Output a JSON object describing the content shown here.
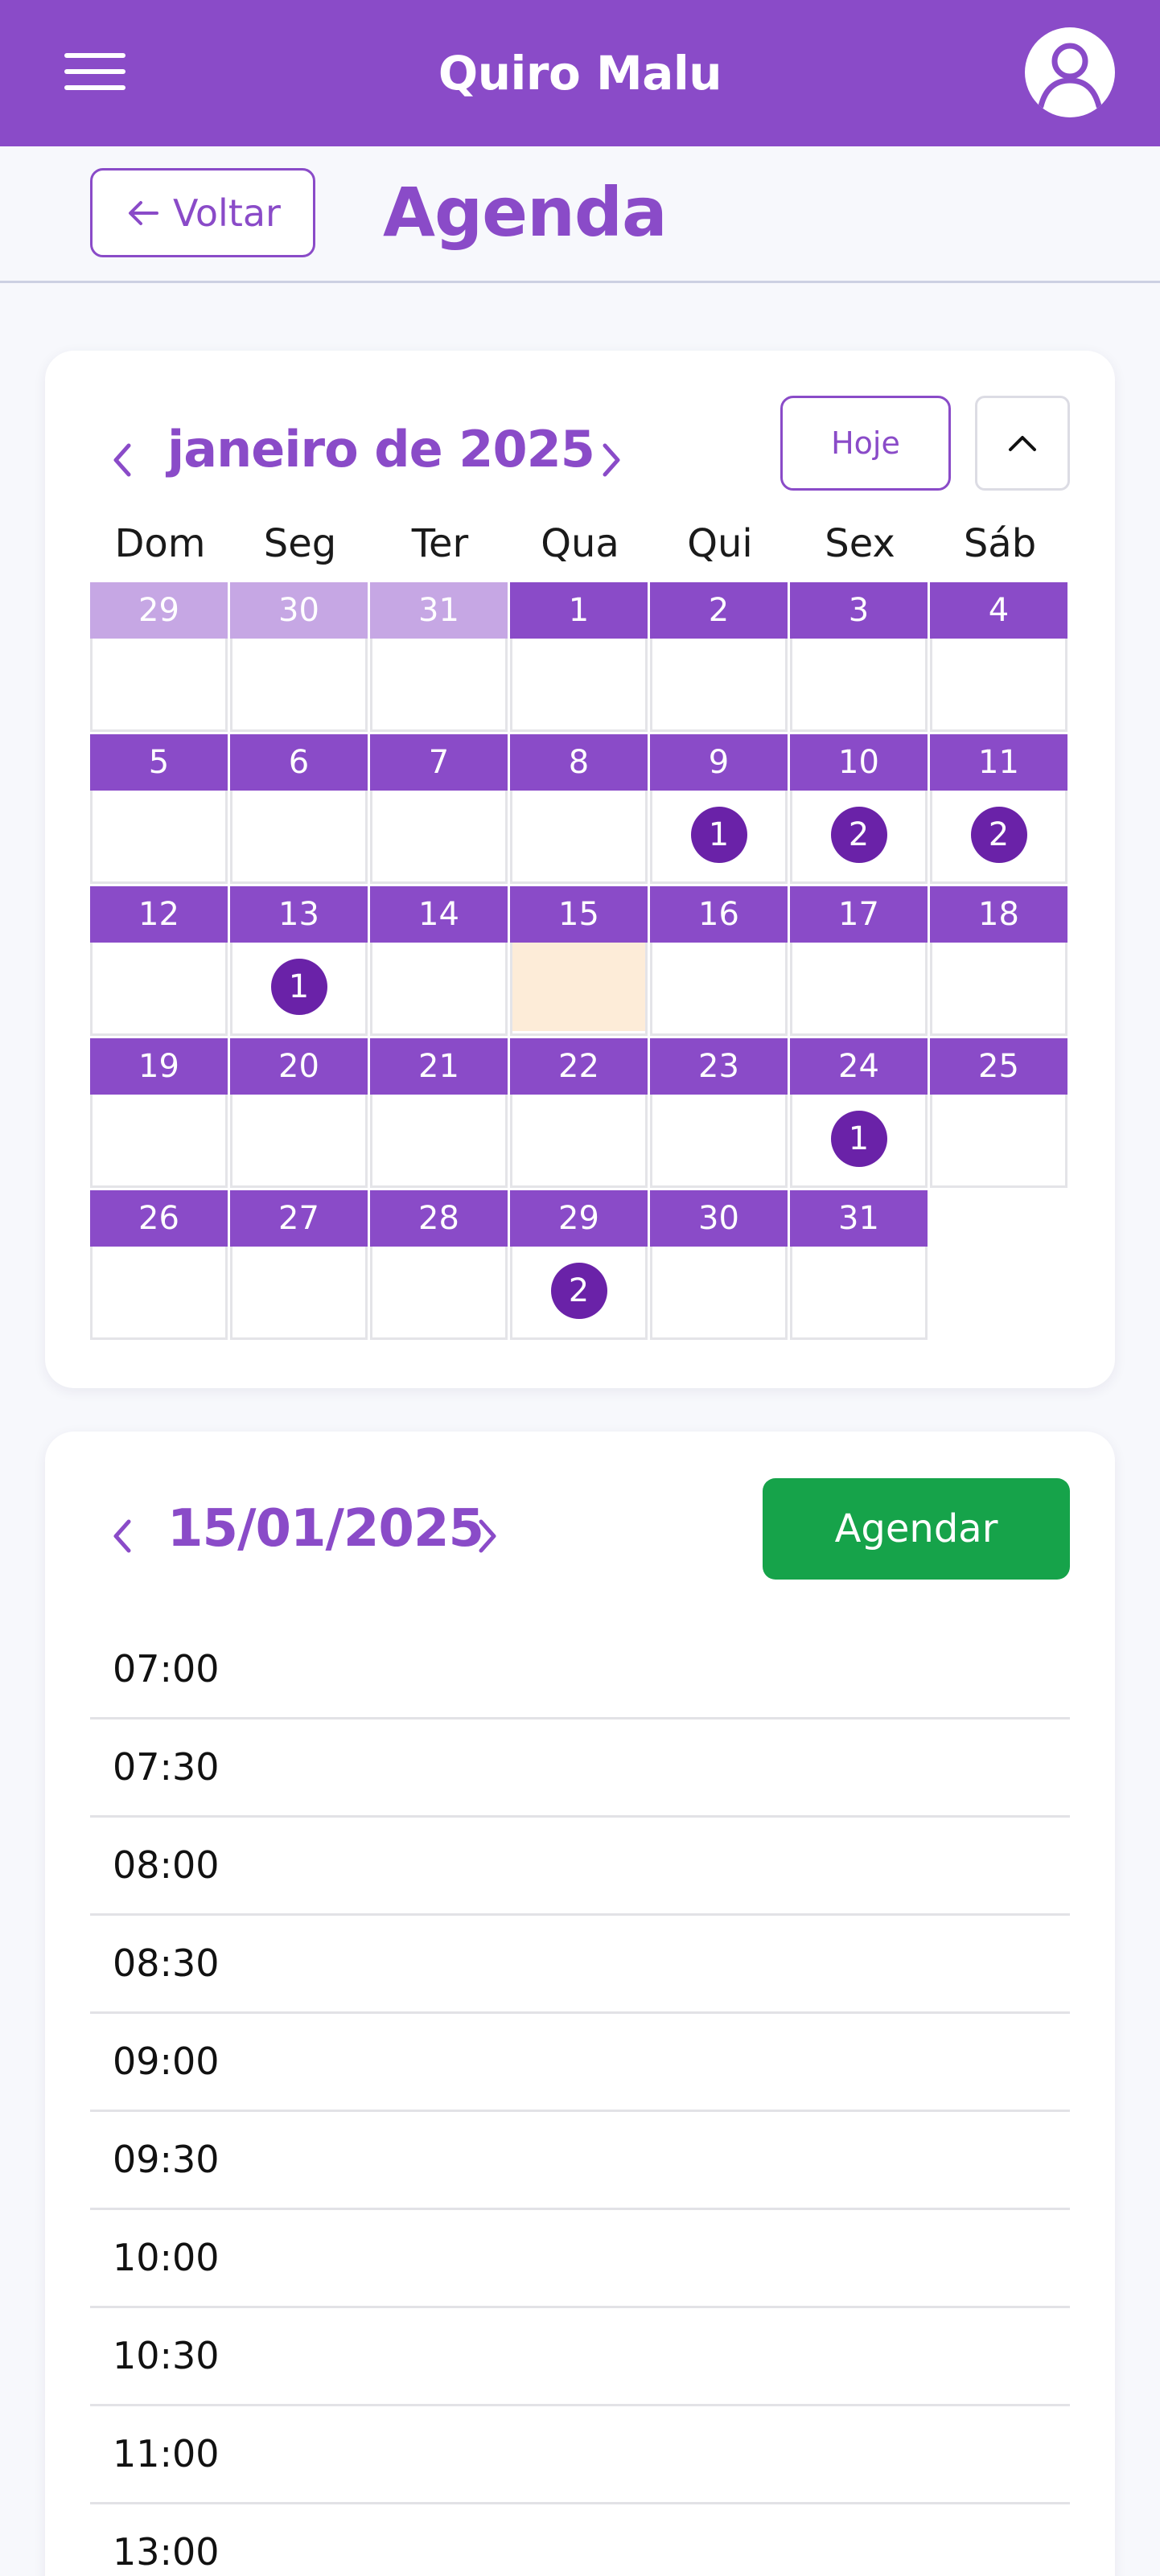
{
  "header": {
    "title": "Quiro Malu",
    "menu_icon": "hamburger-icon",
    "user_icon": "user-icon"
  },
  "subheader": {
    "back_label": "Voltar",
    "page_title": "Agenda"
  },
  "calendar": {
    "month_label": "janeiro de 2025",
    "today_label": "Hoje",
    "weekdays": [
      "Dom",
      "Seg",
      "Ter",
      "Qua",
      "Qui",
      "Sex",
      "Sáb"
    ],
    "weeks": [
      [
        {
          "day": "29",
          "other": true
        },
        {
          "day": "30",
          "other": true
        },
        {
          "day": "31",
          "other": true
        },
        {
          "day": "1"
        },
        {
          "day": "2"
        },
        {
          "day": "3"
        },
        {
          "day": "4"
        }
      ],
      [
        {
          "day": "5"
        },
        {
          "day": "6"
        },
        {
          "day": "7"
        },
        {
          "day": "8"
        },
        {
          "day": "9",
          "count": "1"
        },
        {
          "day": "10",
          "count": "2"
        },
        {
          "day": "11",
          "count": "2"
        }
      ],
      [
        {
          "day": "12"
        },
        {
          "day": "13",
          "count": "1"
        },
        {
          "day": "14"
        },
        {
          "day": "15",
          "selected": true
        },
        {
          "day": "16"
        },
        {
          "day": "17"
        },
        {
          "day": "18"
        }
      ],
      [
        {
          "day": "19"
        },
        {
          "day": "20"
        },
        {
          "day": "21"
        },
        {
          "day": "22"
        },
        {
          "day": "23"
        },
        {
          "day": "24",
          "count": "1"
        },
        {
          "day": "25"
        }
      ],
      [
        {
          "day": "26"
        },
        {
          "day": "27"
        },
        {
          "day": "28"
        },
        {
          "day": "29",
          "count": "2"
        },
        {
          "day": "30"
        },
        {
          "day": "31"
        }
      ]
    ],
    "colors": {
      "accent": "#8a4bc8",
      "other_month": "#c6a7e4",
      "badge": "#6a22a8",
      "selected": "#fdecd8"
    }
  },
  "day_view": {
    "date_label": "15/01/2025",
    "schedule_label": "Agendar",
    "schedule_color": "#16a34a",
    "slots": [
      "07:00",
      "07:30",
      "08:00",
      "08:30",
      "09:00",
      "09:30",
      "10:00",
      "10:30",
      "11:00",
      "13:00"
    ]
  }
}
